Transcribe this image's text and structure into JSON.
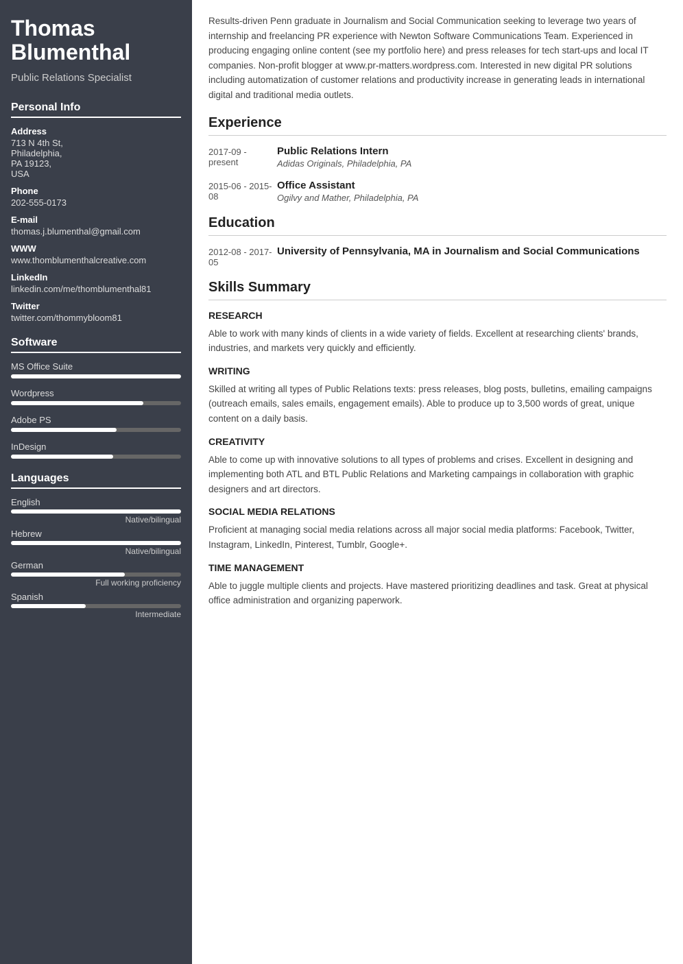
{
  "sidebar": {
    "name": "Thomas Blumenthal",
    "title": "Public Relations Specialist",
    "personal_info_label": "Personal Info",
    "address_label": "Address",
    "address_value": "713 N 4th St, Philadelphia, PA 19123, USA",
    "phone_label": "Phone",
    "phone_value": "202-555-0173",
    "email_label": "E-mail",
    "email_value": "thomas.j.blumenthal@gmail.com",
    "www_label": "WWW",
    "www_value": "www.thomblumenthalcreative.com",
    "linkedin_label": "LinkedIn",
    "linkedin_value": "linkedin.com/me/thomblumenthal81",
    "twitter_label": "Twitter",
    "twitter_value": "twitter.com/thommybloom81",
    "software_label": "Software",
    "software": [
      {
        "name": "MS Office Suite",
        "fill_pct": 100
      },
      {
        "name": "Wordpress",
        "fill_pct": 78
      },
      {
        "name": "Adobe PS",
        "fill_pct": 62
      },
      {
        "name": "InDesign",
        "fill_pct": 60
      }
    ],
    "languages_label": "Languages",
    "languages": [
      {
        "name": "English",
        "fill_pct": 100,
        "level": "Native/bilingual"
      },
      {
        "name": "Hebrew",
        "fill_pct": 100,
        "level": "Native/bilingual"
      },
      {
        "name": "German",
        "fill_pct": 67,
        "level": "Full working proficiency"
      },
      {
        "name": "Spanish",
        "fill_pct": 44,
        "level": "Intermediate"
      }
    ]
  },
  "main": {
    "summary": "Results-driven Penn graduate in Journalism and Social Communication seeking to leverage two years of internship and freelancing PR experience with Newton Software Communications Team. Experienced in producing engaging online content (see my portfolio here) and press releases for tech start-ups and local IT companies. Non-profit blogger at www.pr-matters.wordpress.com. Interested in new digital PR solutions including automatization of customer relations and productivity increase in generating leads in international digital and traditional media outlets.",
    "experience_label": "Experience",
    "experience": [
      {
        "date": "2017-09 - present",
        "title": "Public Relations Intern",
        "company": "Adidas Originals, Philadelphia, PA"
      },
      {
        "date": "2015-06 - 2015-08",
        "title": "Office Assistant",
        "company": "Ogilvy and Mather, Philadelphia, PA"
      }
    ],
    "education_label": "Education",
    "education": [
      {
        "date": "2012-08 - 2017-05",
        "title": "University of Pennsylvania, MA in Journalism and Social Communications"
      }
    ],
    "skills_label": "Skills Summary",
    "skills": [
      {
        "name": "RESEARCH",
        "desc": "Able to work with many kinds of clients in a wide variety of fields. Excellent at researching clients' brands, industries, and markets very quickly and efficiently."
      },
      {
        "name": "WRITING",
        "desc": "Skilled at writing all types of Public Relations texts: press releases, blog posts, bulletins, emailing campaigns (outreach emails, sales emails, engagement emails). Able to produce up to 3,500 words of great, unique content on a daily basis."
      },
      {
        "name": "CREATIVITY",
        "desc": "Able to come up with innovative solutions to all types of problems and crises. Excellent in designing and implementing both ATL and BTL Public Relations and Marketing campaings in collaboration with graphic designers and art directors."
      },
      {
        "name": "SOCIAL MEDIA RELATIONS",
        "desc": "Proficient at managing social media relations across all major social media platforms: Facebook, Twitter, Instagram, LinkedIn, Pinterest, Tumblr, Google+."
      },
      {
        "name": "TIME MANAGEMENT",
        "desc": "Able to juggle multiple clients and projects. Have mastered prioritizing deadlines and task. Great at physical office administration and organizing paperwork."
      }
    ]
  }
}
